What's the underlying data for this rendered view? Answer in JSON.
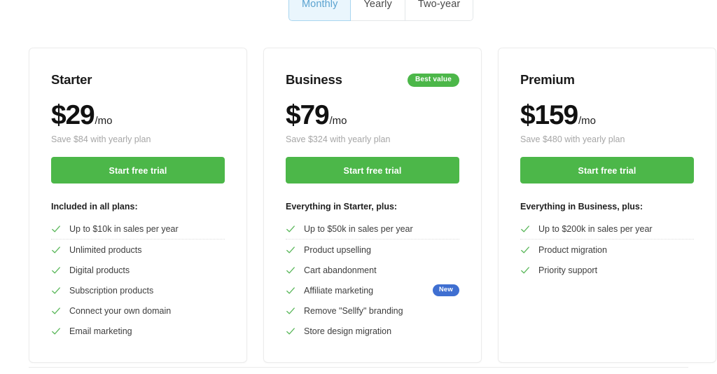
{
  "billing_toggle": {
    "options": [
      {
        "label": "Monthly",
        "active": true
      },
      {
        "label": "Yearly",
        "active": false
      },
      {
        "label": "Two-year",
        "active": false
      }
    ]
  },
  "colors": {
    "cta_green": "#4cb749",
    "badge_best_value": "#4cb749",
    "badge_new": "#3f6fd1",
    "tab_active_bg": "#eaf6fd",
    "tab_active_text": "#5ba3d0",
    "check_green": "#5cb85c",
    "card_border": "#ececec"
  },
  "plans": [
    {
      "name": "Starter",
      "badge": null,
      "price": "$29",
      "period": "/mo",
      "save_text": "Save $84 with yearly plan",
      "cta_label": "Start free trial",
      "features_title": "Included in all plans:",
      "features": [
        {
          "label": "Up to $10k in sales per year",
          "underlined": true,
          "badge": null
        },
        {
          "label": "Unlimited products",
          "underlined": false,
          "badge": null
        },
        {
          "label": "Digital products",
          "underlined": false,
          "badge": null
        },
        {
          "label": "Subscription products",
          "underlined": false,
          "badge": null
        },
        {
          "label": "Connect your own domain",
          "underlined": false,
          "badge": null
        },
        {
          "label": "Email marketing",
          "underlined": false,
          "badge": null
        }
      ]
    },
    {
      "name": "Business",
      "badge": "Best value",
      "price": "$79",
      "period": "/mo",
      "save_text": "Save $324 with yearly plan",
      "cta_label": "Start free trial",
      "features_title": "Everything in Starter, plus:",
      "features": [
        {
          "label": "Up to $50k in sales per year",
          "underlined": true,
          "badge": null
        },
        {
          "label": "Product upselling",
          "underlined": false,
          "badge": null
        },
        {
          "label": "Cart abandonment",
          "underlined": false,
          "badge": null
        },
        {
          "label": "Affiliate marketing",
          "underlined": false,
          "badge": "New"
        },
        {
          "label": "Remove \"Sellfy\" branding",
          "underlined": false,
          "badge": null
        },
        {
          "label": "Store design migration",
          "underlined": false,
          "badge": null
        }
      ]
    },
    {
      "name": "Premium",
      "badge": null,
      "price": "$159",
      "period": "/mo",
      "save_text": "Save $480 with yearly plan",
      "cta_label": "Start free trial",
      "features_title": "Everything in Business, plus:",
      "features": [
        {
          "label": "Up to $200k in sales per year",
          "underlined": true,
          "badge": null
        },
        {
          "label": "Product migration",
          "underlined": false,
          "badge": null
        },
        {
          "label": "Priority support",
          "underlined": false,
          "badge": null
        }
      ]
    }
  ]
}
